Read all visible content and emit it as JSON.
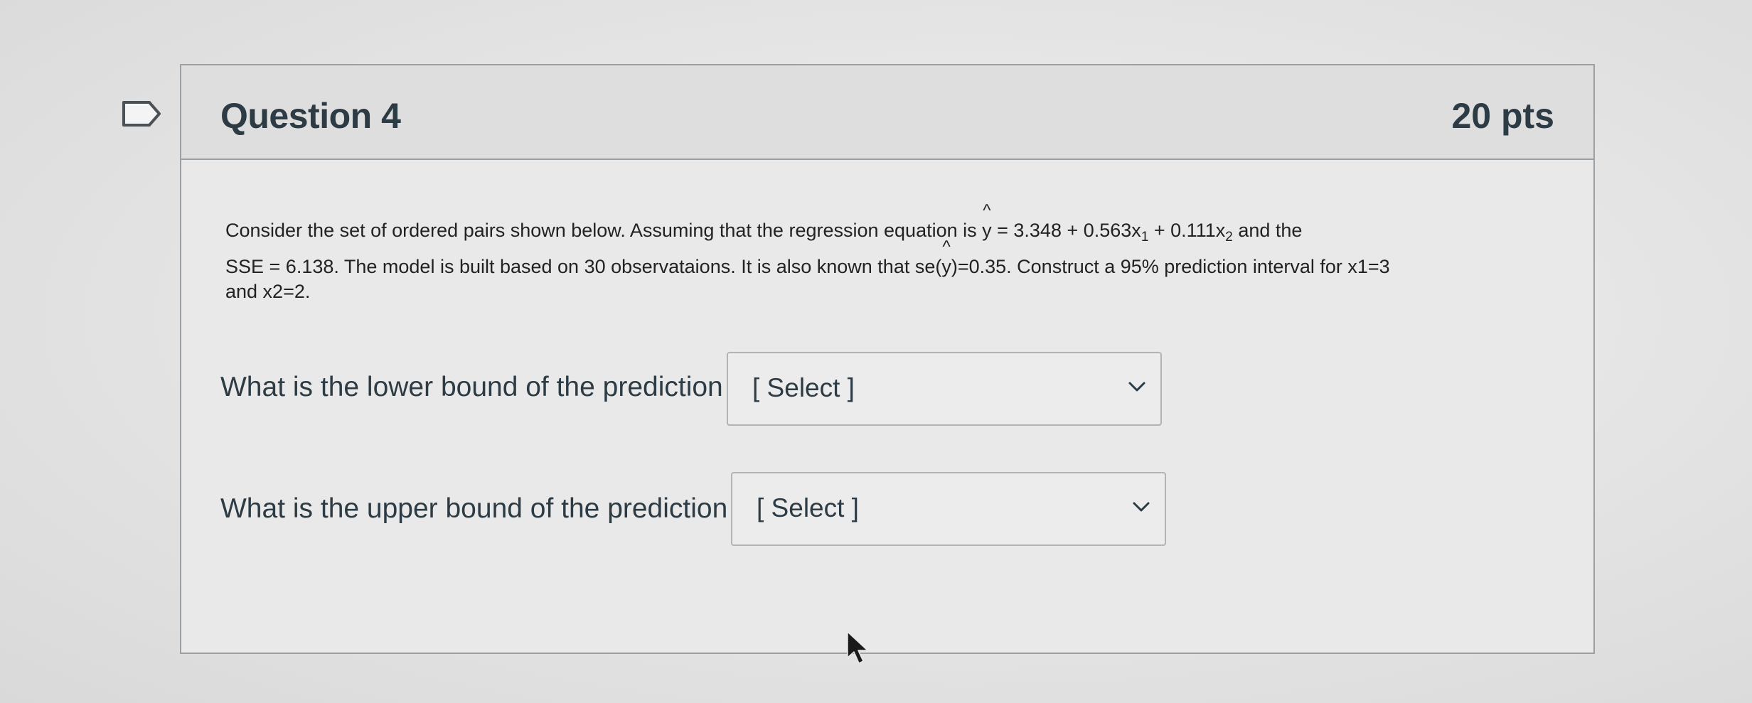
{
  "question": {
    "title": "Question 4",
    "points": "20 pts",
    "text_line1_a": "Consider the set of ordered pairs shown below. Assuming that the regression equation is ",
    "yhat_hat": "^",
    "yhat_y": "y",
    "eq_a": " = 3.348 + 0.563x",
    "sub1": "1",
    "eq_b": " + 0.111x",
    "sub2": "2",
    "eq_c": " and the",
    "text_line2_a": "SSE = 6.138. The model is built based on 30 observataions. It is also known that se(",
    "text_line2_b": ")=0.35. Construct a 95% prediction interval for x1=3",
    "text_line3": "and x2=2."
  },
  "lower": {
    "label": "What is the lower bound of the prediction interval?",
    "selected": "[ Select ]"
  },
  "upper": {
    "label": "What is the upper bound of the prediction interval?",
    "selected": "[ Select ]"
  },
  "icons": {
    "bookmark": "bookmark-outline-icon",
    "dropdown": "chevron-down-icon",
    "pointer": "mouse-pointer-icon"
  },
  "colors": {
    "card_background": "#e9e9e9",
    "header_background": "#dedede",
    "border": "#9aa0a4",
    "text": "#2d3b45"
  }
}
